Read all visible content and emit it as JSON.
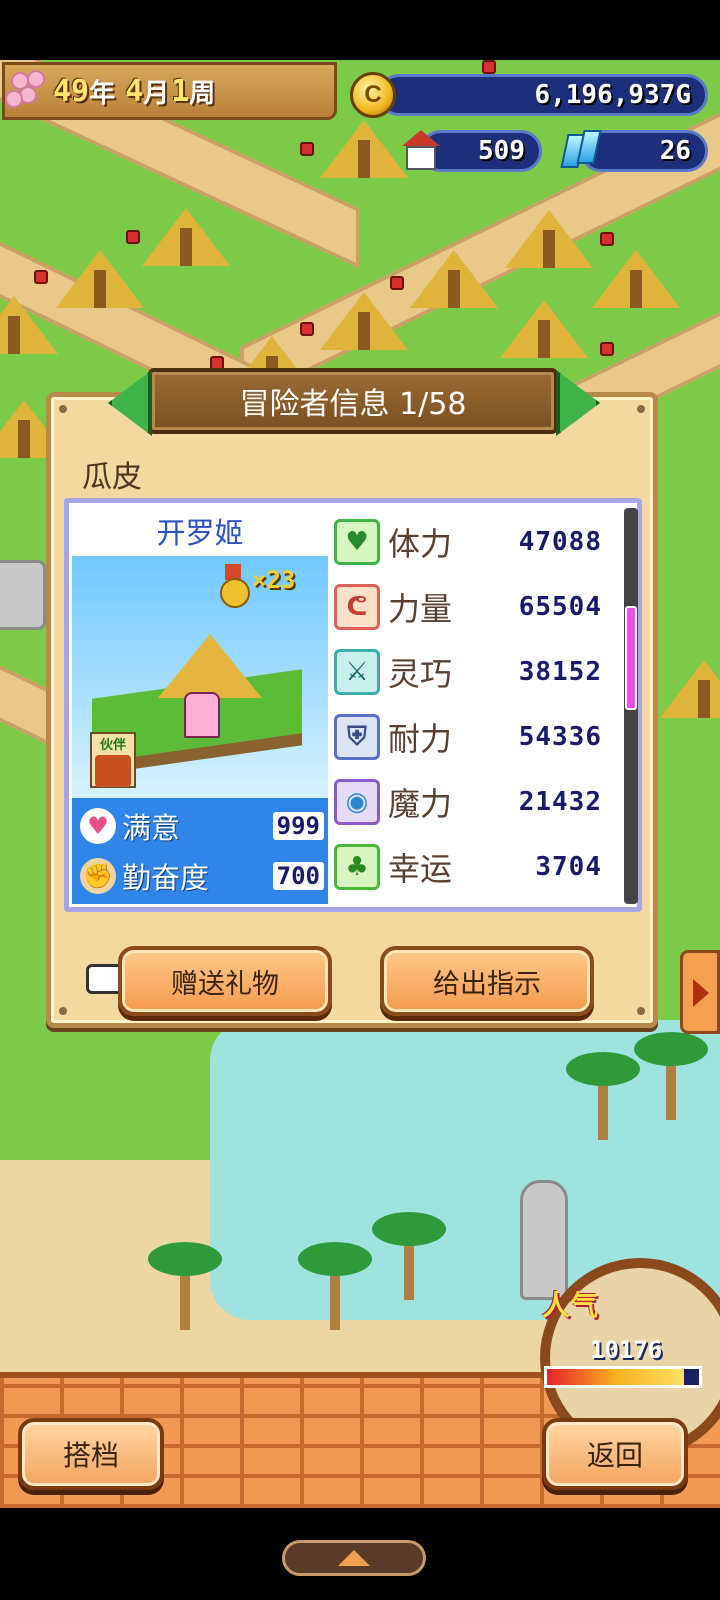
{
  "hud": {
    "year": "49",
    "year_unit": "年",
    "month": "4",
    "month_unit": "月",
    "week": "1",
    "week_unit": "周",
    "money": "6,196,937G",
    "houses": "509",
    "gems": "26",
    "icons": {
      "date": "cherry-blossom-icon",
      "money": "gold-coin-icon",
      "houses": "house-icon",
      "gems": "crystal-icon"
    }
  },
  "panel": {
    "title": "冒险者信息 1/58",
    "adventurer_name": "瓜皮",
    "card": {
      "job": "开罗姬",
      "medal_count": "×23",
      "partner_label": "伙伴",
      "satisfaction_label": "满意",
      "satisfaction_value": "999",
      "diligence_label": "勤奋度",
      "diligence_value": "700"
    },
    "stats": [
      {
        "label": "体力",
        "value": "47088",
        "icon": "heart-icon",
        "color": "#3fb24a"
      },
      {
        "label": "力量",
        "value": "65504",
        "icon": "arm-icon",
        "color": "#e0605a"
      },
      {
        "label": "灵巧",
        "value": "38152",
        "icon": "crossed-swords-icon",
        "color": "#3ab0a8"
      },
      {
        "label": "耐力",
        "value": "54336",
        "icon": "shield-icon",
        "color": "#5a70c8"
      },
      {
        "label": "魔力",
        "value": "21432",
        "icon": "magic-orb-icon",
        "color": "#8a5ad0"
      },
      {
        "label": "幸运",
        "value": "3704",
        "icon": "clover-icon",
        "color": "#4ab83a"
      }
    ],
    "buttons": {
      "gift": "赠送礼物",
      "instruct": "给出指示"
    }
  },
  "popularity": {
    "label": "人气",
    "value": "10176",
    "fill_fraction": 0.9
  },
  "bottom": {
    "partner_button": "搭档",
    "back_button": "返回"
  }
}
